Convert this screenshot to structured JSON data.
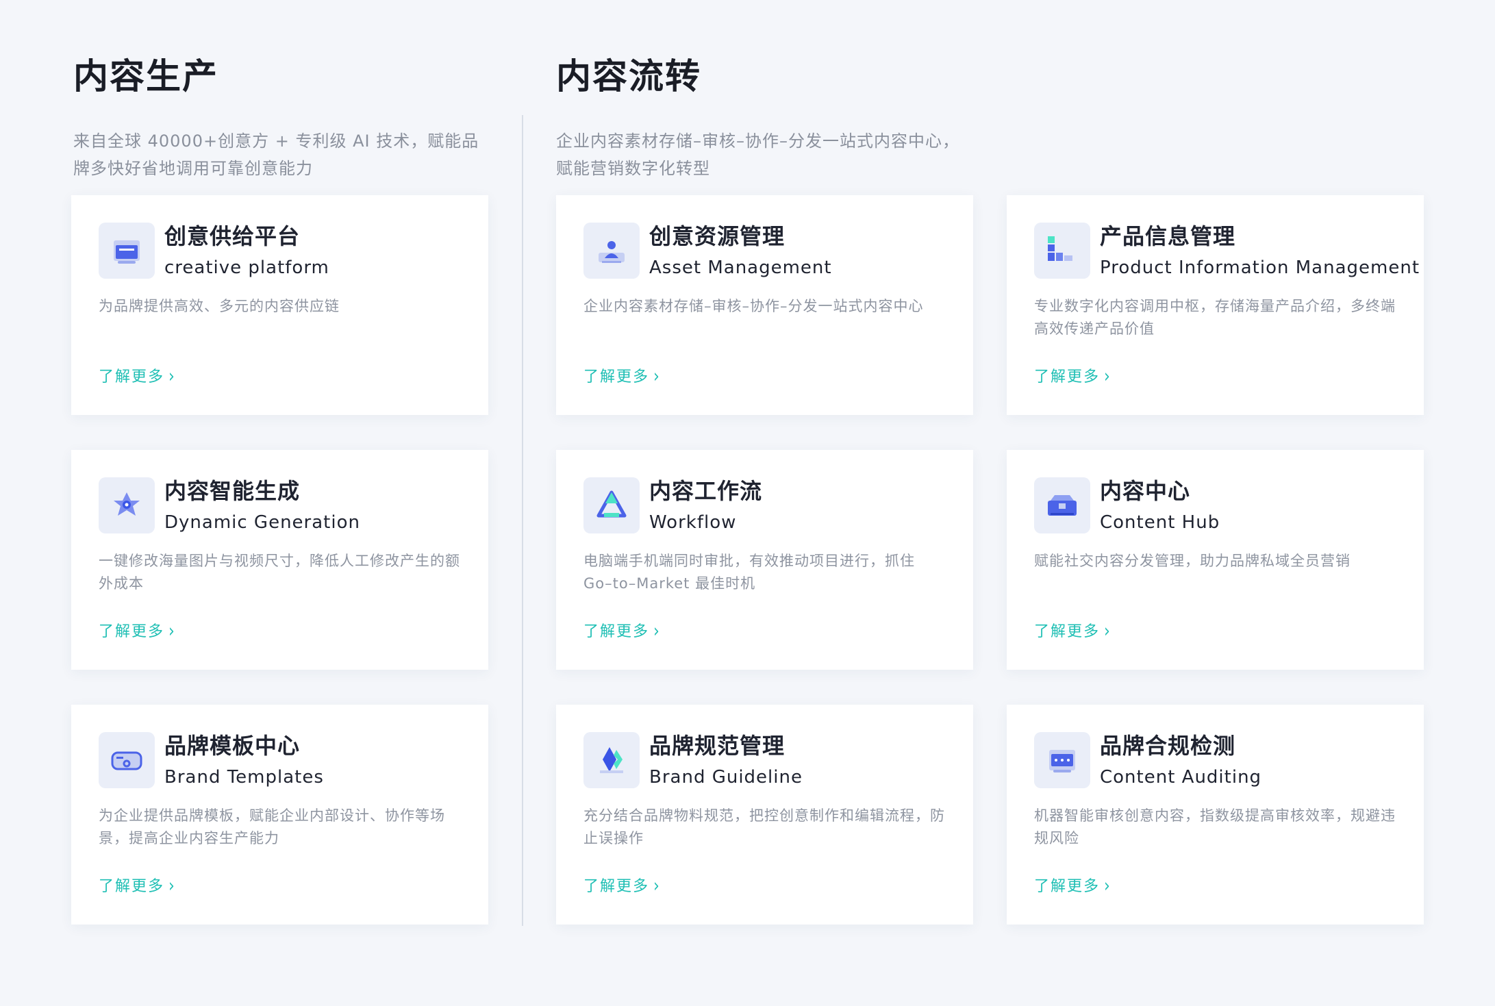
{
  "sections": {
    "production": {
      "title": "内容生产",
      "description": "来自全球 40000+创意方 + 专利级 AI 技术，赋能品牌多快好省地调用可靠创意能力"
    },
    "circulation": {
      "title": "内容流转",
      "description": "企业内容素材存储–审核–协作–分发一站式内容中心，赋能营销数字化转型"
    }
  },
  "link_label": "了解更多",
  "link_chevron": "›",
  "accent_color": "#1fbfb4",
  "cards": {
    "creative_platform": {
      "title": "创意供给平台",
      "subtitle": "creative platform",
      "description": "为品牌提供高效、多元的内容供应链",
      "icon": "creative-platform-icon"
    },
    "asset_management": {
      "title": "创意资源管理",
      "subtitle": "Asset Management",
      "description": "企业内容素材存储–审核–协作–分发一站式内容中心",
      "icon": "asset-management-icon"
    },
    "product_info": {
      "title": "产品信息管理",
      "subtitle": "Product Information Management",
      "description": "专业数字化内容调用中枢，存储海量产品介绍，多终端高效传递产品价值",
      "icon": "product-information-icon"
    },
    "dynamic_generation": {
      "title": "内容智能生成",
      "subtitle": "Dynamic Generation",
      "description": "一键修改海量图片与视频尺寸，降低人工修改产生的额外成本",
      "icon": "dynamic-generation-icon"
    },
    "workflow": {
      "title": "内容工作流",
      "subtitle": "Workflow",
      "description": "电脑端手机端同时审批，有效推动项目进行，抓住 Go–to–Market 最佳时机",
      "icon": "workflow-icon"
    },
    "content_hub": {
      "title": "内容中心",
      "subtitle": "Content Hub",
      "description": "赋能社交内容分发管理，助力品牌私域全员营销",
      "icon": "content-hub-icon"
    },
    "brand_templates": {
      "title": "品牌模板中心",
      "subtitle": "Brand Templates",
      "description": "为企业提供品牌模板，赋能企业内部设计、协作等场景，提高企业内容生产能力",
      "icon": "brand-templates-icon"
    },
    "brand_guideline": {
      "title": "品牌规范管理",
      "subtitle": "Brand Guideline",
      "description": "充分结合品牌物料规范，把控创意制作和编辑流程，防止误操作",
      "icon": "brand-guideline-icon"
    },
    "content_auditing": {
      "title": "品牌合规检测",
      "subtitle": "Content Auditing",
      "description": "机器智能审核创意内容，指数级提高审核效率，规避违规风险",
      "icon": "content-auditing-icon"
    }
  }
}
